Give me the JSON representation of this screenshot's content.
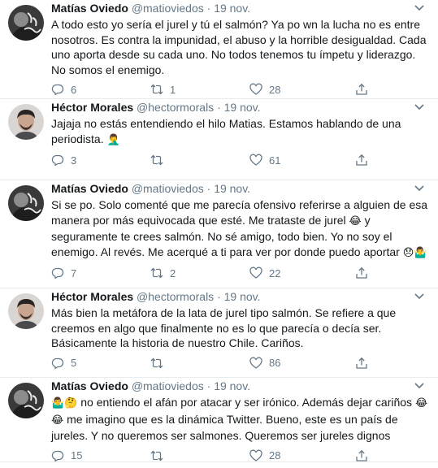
{
  "tweets": [
    {
      "name": "Matías Oviedo",
      "handle": "@matioviedos",
      "dot": "·",
      "time": "19 nov.",
      "text": "A todo esto yo sería el jurel y tú el salmón? Ya po wn la lucha no es entre nosotros. Es contra la impunidad, el abuso y la horrible desigualdad. Cada uno aporta desde su cada uno. No todos tenemos tu ímpetu y liderazgo. No somos el enemigo.",
      "replies": "6",
      "retweets": "1",
      "likes": "28"
    },
    {
      "name": "Héctor Morales",
      "handle": "@hectormorals",
      "dot": "·",
      "time": "19 nov.",
      "text": "Jajaja no estás entendiendo el hilo Matias. Estamos hablando de una periodista.",
      "emoji": "🤦‍♂️",
      "replies": "3",
      "retweets": "",
      "likes": "61"
    },
    {
      "name": "Matías Oviedo",
      "handle": "@matioviedos",
      "dot": "·",
      "time": "19 nov.",
      "text_a": "Si se po. Solo comenté que me parecía ofensivo referirse a alguien de esa manera por más equivocada que esté. Me trataste de jurel",
      "emoji_a": "😂",
      "text_b": "y seguramente te crees salmón. No sé amigo, todo bien. Yo no soy el enemigo. Al revés. Me acerqué a ti para ver por donde puedo aportar",
      "emoji_b": "😞🤷‍♂️",
      "replies": "7",
      "retweets": "2",
      "likes": "22"
    },
    {
      "name": "Héctor Morales",
      "handle": "@hectormorals",
      "dot": "·",
      "time": "19 nov.",
      "text": "Más bien la metáfora de la lata de jurel tipo salmón. Se refiere a que creemos en algo que finalmente no es lo que parecía o decía ser. Básicamente la historia de nuestro Chile. Cariños.",
      "replies": "5",
      "retweets": "",
      "likes": "86"
    },
    {
      "name": "Matías Oviedo",
      "handle": "@matioviedos",
      "dot": "·",
      "time": "19 nov.",
      "emoji_a": "🤷‍♂️🤔",
      "text_a": "no entiendo el afán por atacar y ser irónico. Además dejar cariños",
      "emoji_b": "😂😂",
      "text_b": "me imagino que es la dinámica Twitter. Bueno, este es un país de jureles. Y no queremos ser salmones. Queremos ser jureles dignos",
      "replies": "15",
      "retweets": "",
      "likes": "28"
    }
  ]
}
